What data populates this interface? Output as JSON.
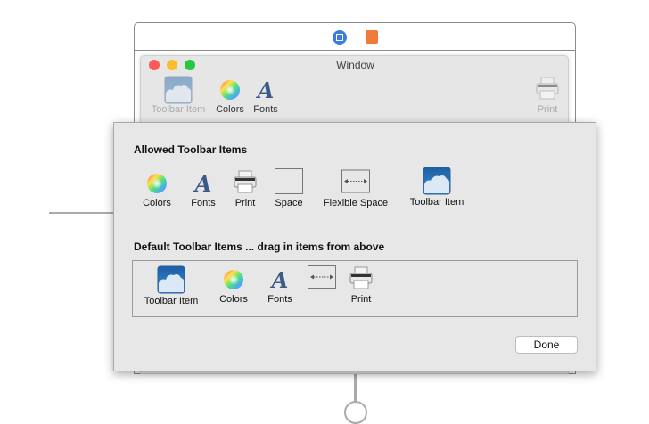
{
  "window": {
    "title": "Window",
    "toolbar": [
      {
        "label": "Toolbar Item",
        "icon": "cloud-icon",
        "disabled": true
      },
      {
        "label": "Colors",
        "icon": "color-wheel-icon"
      },
      {
        "label": "Fonts",
        "icon": "fonts-icon"
      },
      {
        "label": "Print",
        "icon": "printer-icon",
        "disabled": true
      }
    ]
  },
  "sheet": {
    "allowed_title": "Allowed Toolbar Items",
    "allowed": [
      "Colors",
      "Fonts",
      "Print",
      "Space",
      "Flexible Space",
      "Toolbar Item"
    ],
    "default_title": "Default Toolbar Items ... drag in items from above",
    "defaults": [
      "Toolbar Item",
      "Colors",
      "Fonts",
      "Print"
    ],
    "done_label": "Done"
  }
}
